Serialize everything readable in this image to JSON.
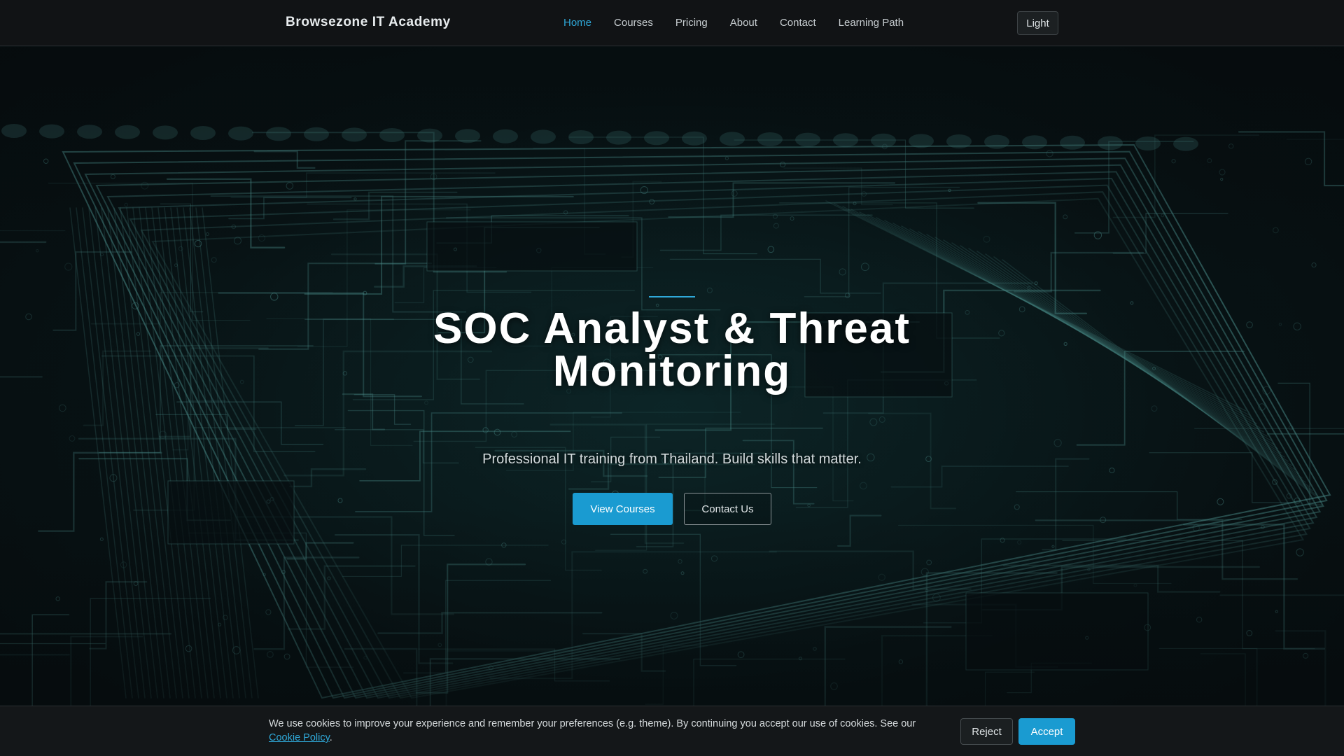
{
  "brand": {
    "name": "Browsezone IT Academy"
  },
  "nav": {
    "items": [
      {
        "label": "Home",
        "active": true
      },
      {
        "label": "Courses",
        "active": false
      },
      {
        "label": "Pricing",
        "active": false
      },
      {
        "label": "About",
        "active": false
      },
      {
        "label": "Contact",
        "active": false
      },
      {
        "label": "Learning Path",
        "active": false
      }
    ],
    "theme_toggle_label": "Light"
  },
  "hero": {
    "title_line1": "SOC Analyst & Threat",
    "title_line2": "Monitoring",
    "subtitle": "Professional IT training from Thailand. Build skills that matter.",
    "primary_cta": "View Courses",
    "secondary_cta": "Contact Us",
    "background_image": "circuit-board"
  },
  "cookie": {
    "text_before_link": "We use cookies to improve your experience and remember your preferences (e.g. theme). By continuing you accept our use of cookies. See our ",
    "link_label": "Cookie Policy",
    "text_after_link": ".",
    "reject_label": "Reject",
    "accept_label": "Accept"
  },
  "colors": {
    "accent": "#1a9bd1",
    "nav_active": "#2fa8d8",
    "navbar_bg": "#111315",
    "circuit_trace": "#5fb4b0"
  }
}
